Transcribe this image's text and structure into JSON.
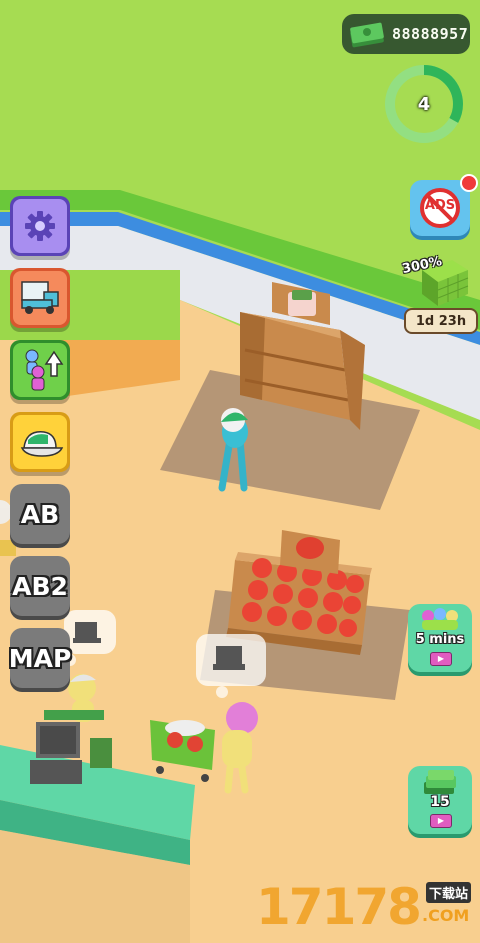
{
  "hud": {
    "money": "88888957",
    "level": "4",
    "level_progress": 0.33
  },
  "left_menu": {
    "settings_icon": "gear-icon",
    "truck_icon": "delivery-truck-icon",
    "upgrade_icon": "worker-upgrade-icon",
    "cap_icon": "cap-icon",
    "ab_label": "AB",
    "ab2_label": "AB2",
    "map_label": "MAP"
  },
  "right_menu": {
    "no_ads_label": "ADS",
    "offer_badge": "300%",
    "offer_timer": "1d 23h",
    "helpers_timer": "5 mins",
    "cash_amount": "15"
  },
  "watermark": {
    "digits": "17178",
    "suffix": "下载站",
    "domain": ".COM"
  },
  "colors": {
    "grass": "#a6dc52",
    "floor": "#f7cf8e",
    "accent_green": "#5fd7a6",
    "progress_ring": "#2fb55a",
    "money_panel": "#2f4f2e"
  }
}
